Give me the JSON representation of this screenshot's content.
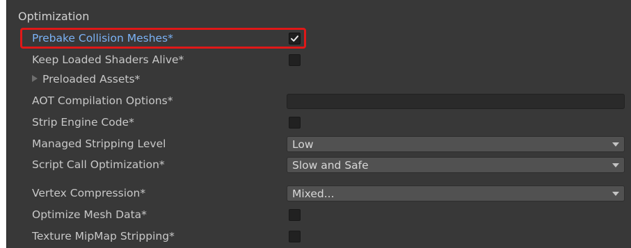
{
  "section": {
    "title": "Optimization"
  },
  "rows": {
    "prebake_collision_meshes": {
      "label": "Prebake Collision Meshes*",
      "checked": true
    },
    "keep_loaded_shaders_alive": {
      "label": "Keep Loaded Shaders Alive*",
      "checked": false
    },
    "preloaded_assets": {
      "label": "Preloaded Assets*"
    },
    "aot_compilation_options": {
      "label": "AOT Compilation Options*",
      "value": ""
    },
    "strip_engine_code": {
      "label": "Strip Engine Code*",
      "checked": false
    },
    "managed_stripping_level": {
      "label": "Managed Stripping Level",
      "value": "Low"
    },
    "script_call_optimization": {
      "label": "Script Call Optimization*",
      "value": "Slow and Safe"
    },
    "vertex_compression": {
      "label": "Vertex Compression*",
      "value": "Mixed..."
    },
    "optimize_mesh_data": {
      "label": "Optimize Mesh Data*",
      "checked": false
    },
    "texture_mipmap_stripping": {
      "label": "Texture MipMap Stripping*",
      "checked": false
    }
  },
  "colors": {
    "panel_background": "#383838",
    "label_text": "#c8c8c8",
    "highlighted_label_text": "#7bb2f5",
    "annotation_box": "#e01818",
    "dropdown_background": "#515151",
    "checkbox_background": "#212121"
  },
  "icons": {
    "checkmark": "checkmark-icon",
    "foldout": "triangle-right-icon",
    "dropdown": "chevron-down-icon"
  }
}
